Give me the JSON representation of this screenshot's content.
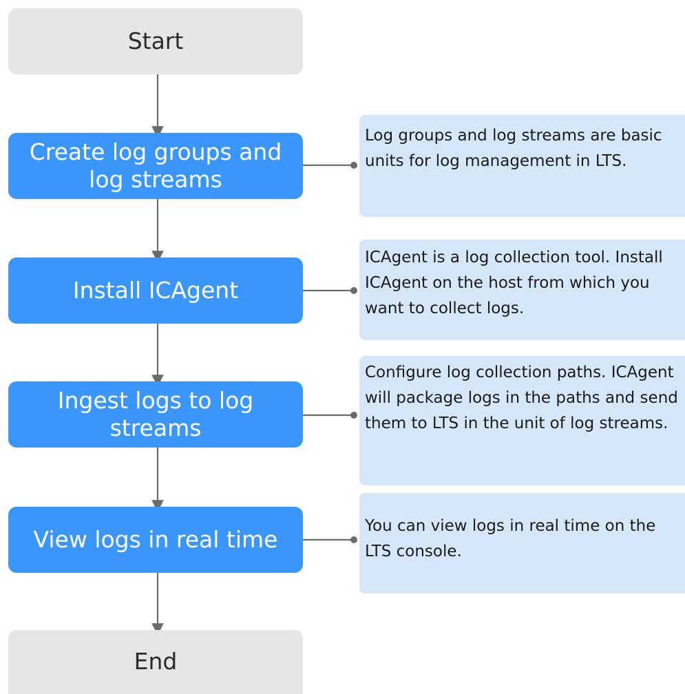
{
  "flowchart": {
    "start_label": "Start",
    "end_label": "End",
    "steps": [
      {
        "label": "Create log groups and log streams",
        "note": "Log groups and log streams are basic units for log management in LTS."
      },
      {
        "label": "Install ICAgent",
        "note": "ICAgent is a log collection tool. Install ICAgent on the host from which you want to collect logs."
      },
      {
        "label": "Ingest logs to log streams",
        "note": "Configure log collection paths. ICAgent will package logs in the paths and send them to LTS in the unit of log streams."
      },
      {
        "label": "View logs in real time",
        "note": "You can view logs in real time on the LTS console."
      }
    ]
  },
  "colors": {
    "step_fill": "#3a96fb",
    "terminal_fill": "#e6e6e6",
    "note_fill": "#d6e7fa",
    "connector": "#6b6b6b"
  }
}
